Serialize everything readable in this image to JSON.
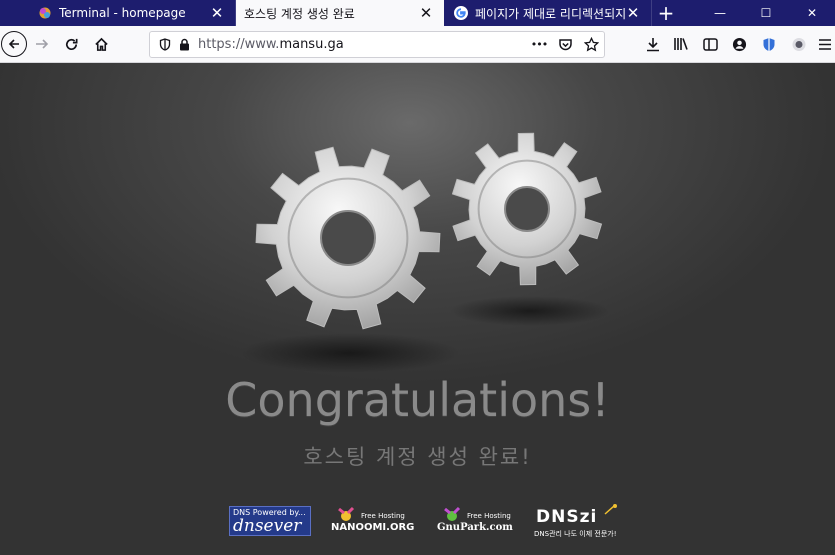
{
  "tabs": [
    {
      "title": "Terminal - homepage",
      "favicon": "colorful-gear-favicon",
      "active": false
    },
    {
      "title": "호스팅 계정 생성 완료",
      "favicon": "",
      "active": true
    },
    {
      "title": "페이지가 제대로 리디렉션되지",
      "favicon": "google-favicon",
      "active": false
    }
  ],
  "toolbar": {
    "close_glyph": "✕",
    "new_tab_glyph": "+",
    "minimize_glyph": "—",
    "maximize_glyph": "☐",
    "window_close_glyph": "✕"
  },
  "address_bar": {
    "url_prefix": "https://www.",
    "url_domain": "mansu.ga",
    "more_glyph": "•••"
  },
  "page": {
    "headline": "Congratulations!",
    "subheadline": "호스팅 계정 생성 완료!"
  },
  "logos": {
    "dnsever": {
      "line1": "DNS Powered by...",
      "line2": "dnsever"
    },
    "nanoomi": {
      "line1": "Free Hosting",
      "line2": "NANOOMI.ORG"
    },
    "gnupark": {
      "line1": "Free Hosting",
      "line2": "GnuPark.com"
    },
    "dnszi": {
      "line1": "DNSzi",
      "line2": "DNS관리 나도 이제 전문가!"
    }
  },
  "colors": {
    "tabstrip": "#1d1d6e",
    "toolbar": "#f9f9fb",
    "content_bg": "#474747"
  }
}
